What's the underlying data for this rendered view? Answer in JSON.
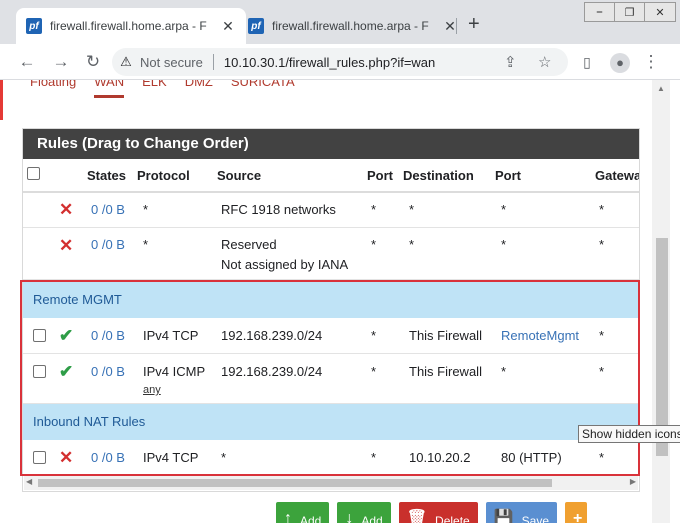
{
  "browser": {
    "tabs": [
      {
        "title": "firewall.firewall.home.arpa - F",
        "favicon": "pf",
        "active": true
      },
      {
        "title": "firewall.firewall.home.arpa - F",
        "favicon": "pf",
        "active": false
      }
    ],
    "new_tab_glyph": "+",
    "window_controls": [
      "⎯",
      "❐",
      "✕"
    ],
    "security_label": "Not secure",
    "url": "10.10.30.1/firewall_rules.php?if=wan"
  },
  "subtabs": [
    "Floating",
    "WAN",
    "ELK",
    "DMZ",
    "SURICATA"
  ],
  "active_subtab": "WAN",
  "panel": {
    "title": "Rules (Drag to Change Order)",
    "columns": [
      "States",
      "Protocol",
      "Source",
      "Port",
      "Destination",
      "Port",
      "Gatewa"
    ]
  },
  "rows": [
    {
      "states": "0 /0 B",
      "protocol": "*",
      "source": "RFC 1918 networks",
      "source2": "",
      "port": "*",
      "destination": "*",
      "dport": "*",
      "gateway": "*"
    },
    {
      "states": "0 /0 B",
      "protocol": "*",
      "source": "Reserved",
      "source2": "Not assigned by IANA",
      "port": "*",
      "destination": "*",
      "dport": "*",
      "gateway": "*"
    }
  ],
  "separators": [
    "Remote MGMT",
    "Inbound NAT Rules"
  ],
  "mgmt_rows": [
    {
      "states": "0 /0 B",
      "protocol": "IPv4 TCP",
      "sub": "",
      "source": "192.168.239.0/24",
      "port": "*",
      "destination": "This Firewall",
      "dport": "RemoteMgmt",
      "gateway": "*"
    },
    {
      "states": "0 /0 B",
      "protocol": "IPv4 ICMP",
      "sub": "any",
      "source": "192.168.239.0/24",
      "port": "*",
      "destination": "This Firewall",
      "dport": "*",
      "gateway": "*"
    }
  ],
  "nat_rows": [
    {
      "states": "0 /0 B",
      "protocol": "IPv4 TCP",
      "source": "*",
      "port": "*",
      "destination": "10.10.20.2",
      "dport": "80 (HTTP)",
      "gateway": "*"
    }
  ],
  "actions": [
    {
      "label": "Add",
      "icon": "arrow-up-icon",
      "color": "#3ca33c"
    },
    {
      "label": "Add",
      "icon": "arrow-down-icon",
      "color": "#3ca33c"
    },
    {
      "label": "Delete",
      "icon": "trash-icon",
      "color": "#c9302c"
    },
    {
      "label": "Save",
      "icon": "save-icon",
      "color": "#5a8fd1"
    }
  ],
  "tooltip": "Show hidden icons",
  "colors": {
    "accent": "#b03a2e",
    "separator_bg": "#bfe3f6",
    "highlight_box": "#d9323a",
    "pass": "#2e9d47",
    "block": "#d32f2f"
  }
}
